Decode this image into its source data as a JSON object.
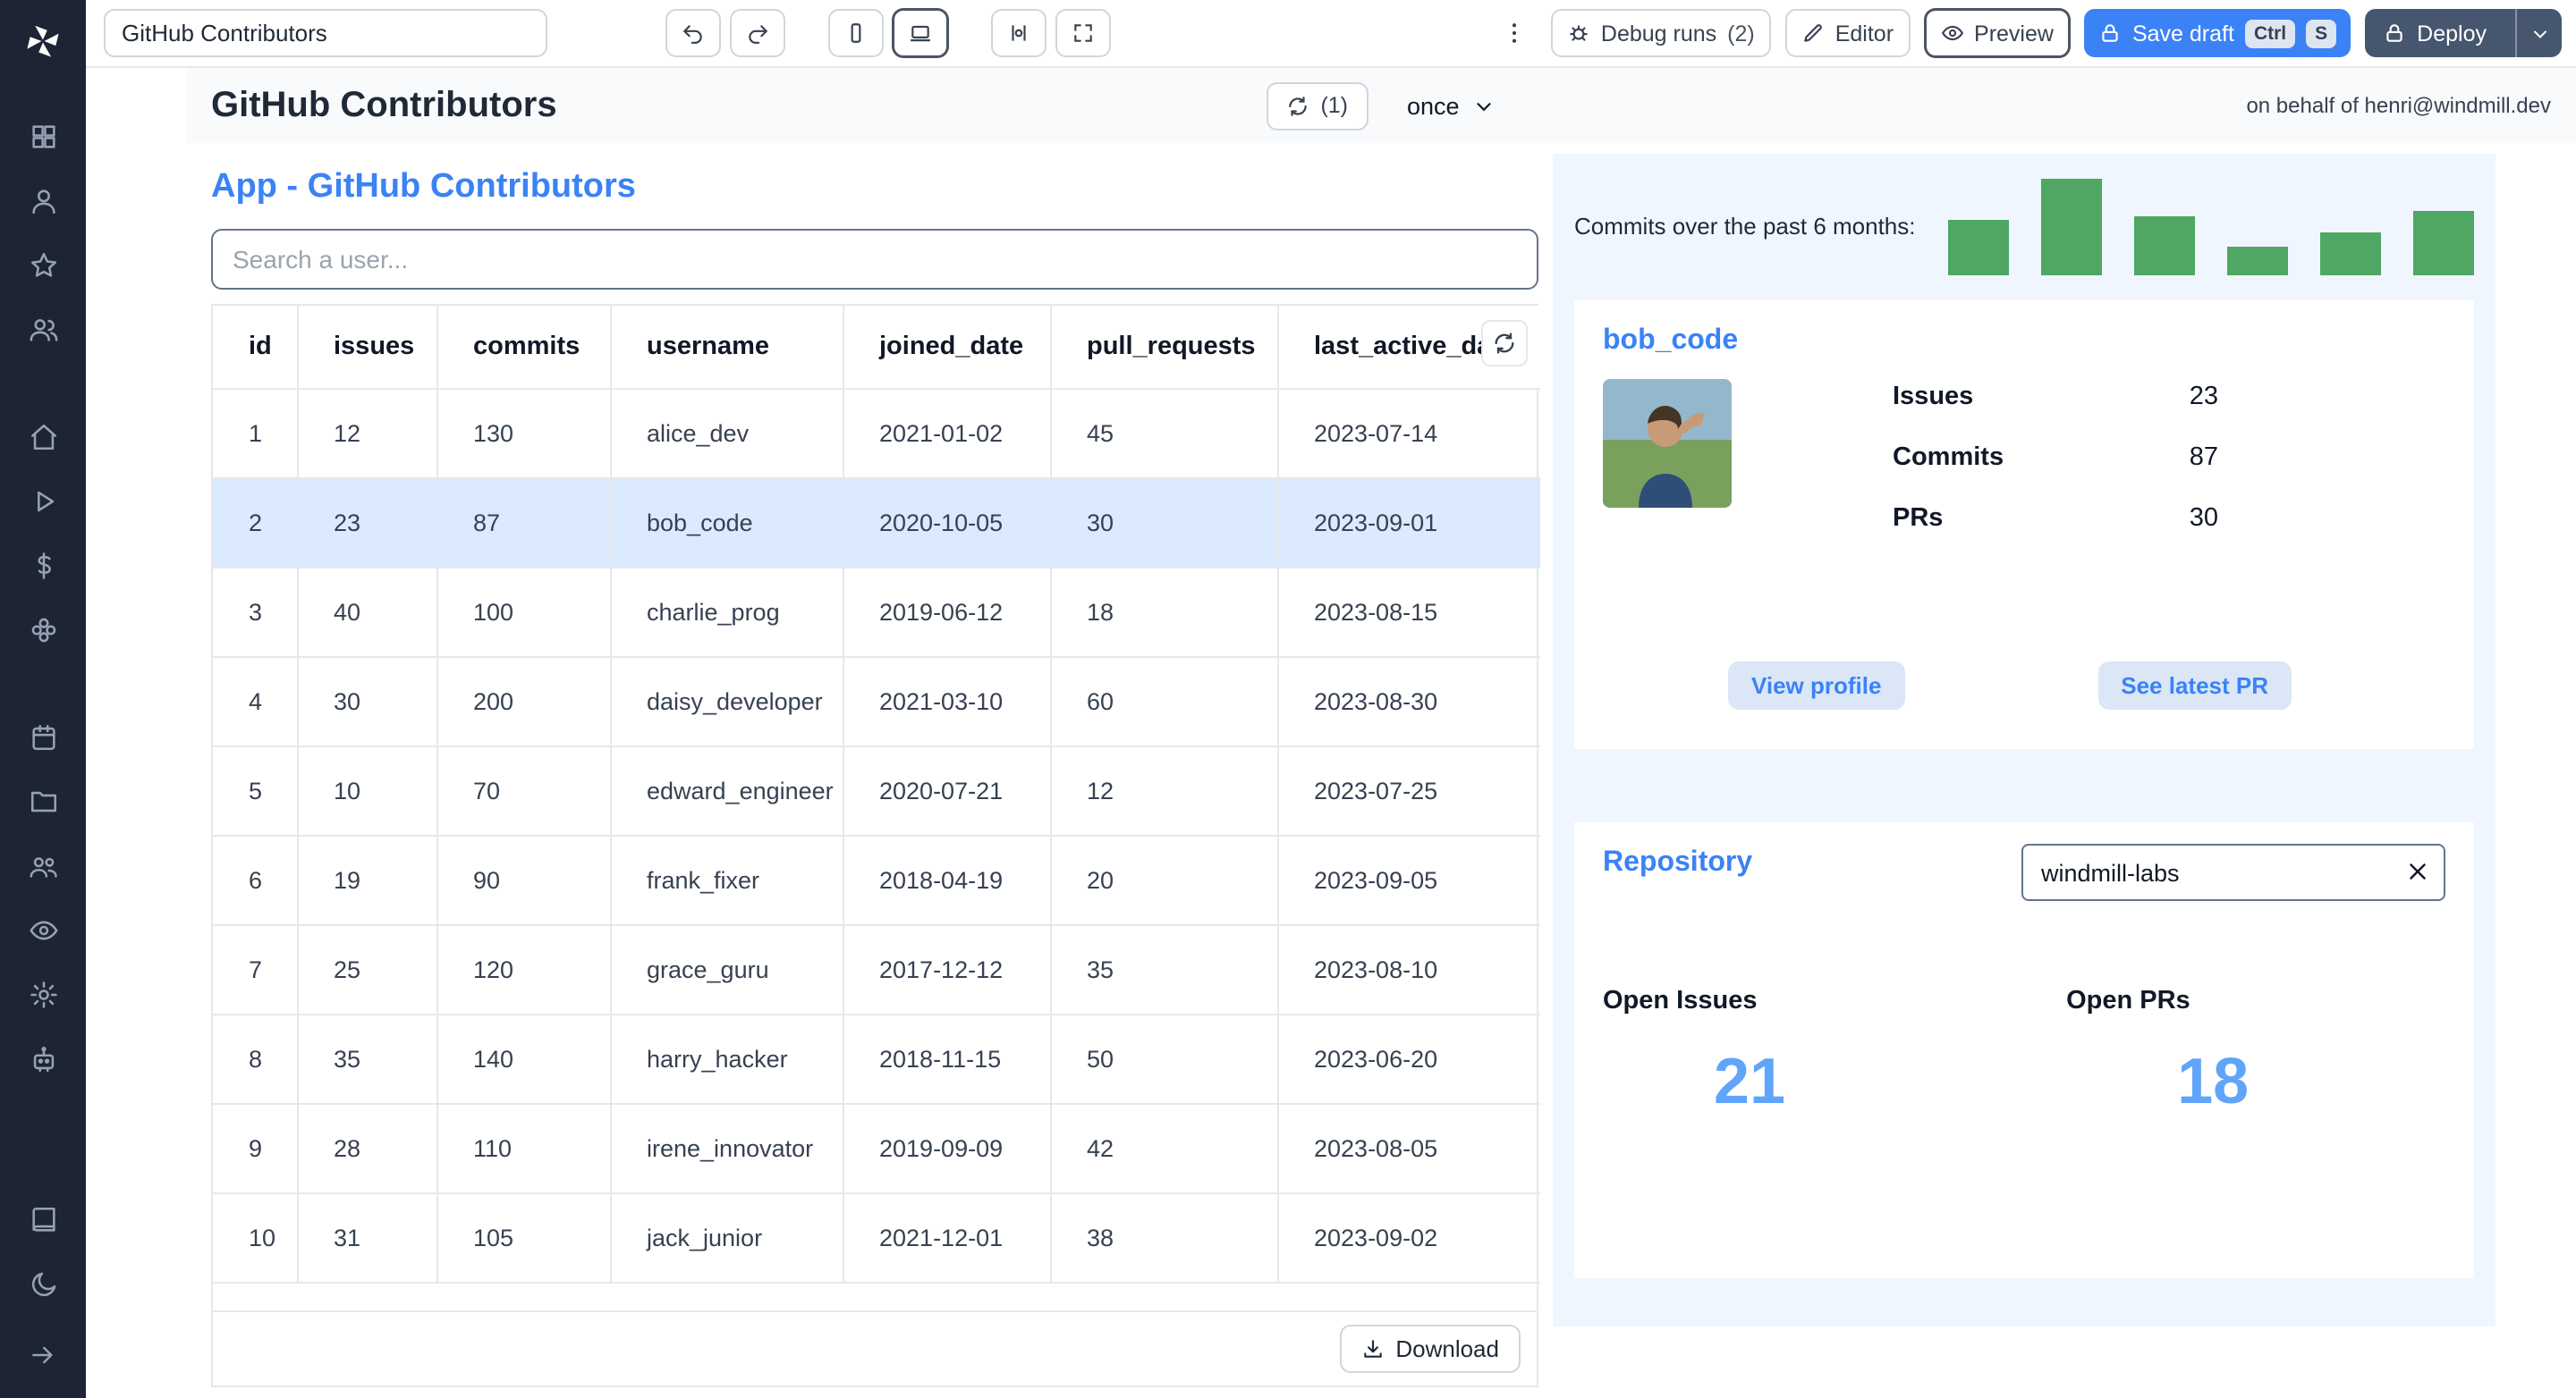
{
  "topbar": {
    "app_name_value": "GitHub Contributors",
    "debug_runs_label": "Debug runs",
    "debug_runs_count": "(2)",
    "editor_label": "Editor",
    "preview_label": "Preview",
    "save_draft_label": "Save draft",
    "save_kbd": [
      "Ctrl",
      "S"
    ],
    "deploy_label": "Deploy"
  },
  "sidebar": {
    "groups": [
      [
        "grid",
        "user",
        "star",
        "users"
      ],
      [
        "home",
        "play",
        "dollar",
        "flower"
      ],
      [
        "calendar",
        "folder",
        "team",
        "eye",
        "gear",
        "bot"
      ],
      [
        "book",
        "moon"
      ]
    ],
    "footer_icon": "arrow-right"
  },
  "header": {
    "title": "GitHub Contributors",
    "refresh_count": "(1)",
    "schedule_value": "once",
    "on_behalf": "on behalf of henri@windmill.dev"
  },
  "main": {
    "app_title": "App - GitHub Contributors",
    "search_placeholder": "Search a user...",
    "table": {
      "columns": [
        "id",
        "issues",
        "commits",
        "username",
        "joined_date",
        "pull_requests",
        "last_active_date"
      ],
      "rows": [
        [
          "1",
          "12",
          "130",
          "alice_dev",
          "2021-01-02",
          "45",
          "2023-07-14"
        ],
        [
          "2",
          "23",
          "87",
          "bob_code",
          "2020-10-05",
          "30",
          "2023-09-01"
        ],
        [
          "3",
          "40",
          "100",
          "charlie_prog",
          "2019-06-12",
          "18",
          "2023-08-15"
        ],
        [
          "4",
          "30",
          "200",
          "daisy_developer",
          "2021-03-10",
          "60",
          "2023-08-30"
        ],
        [
          "5",
          "10",
          "70",
          "edward_engineer",
          "2020-07-21",
          "12",
          "2023-07-25"
        ],
        [
          "6",
          "19",
          "90",
          "frank_fixer",
          "2018-04-19",
          "20",
          "2023-09-05"
        ],
        [
          "7",
          "25",
          "120",
          "grace_guru",
          "2017-12-12",
          "35",
          "2023-08-10"
        ],
        [
          "8",
          "35",
          "140",
          "harry_hacker",
          "2018-11-15",
          "50",
          "2023-06-20"
        ],
        [
          "9",
          "28",
          "110",
          "irene_innovator",
          "2019-09-09",
          "42",
          "2023-08-05"
        ],
        [
          "10",
          "31",
          "105",
          "jack_junior",
          "2021-12-01",
          "38",
          "2023-09-02"
        ]
      ],
      "selected_row_index": 1,
      "download_label": "Download"
    }
  },
  "right": {
    "chart": {
      "type": "bar",
      "label": "Commits over the past 6 months:",
      "values": [
        31,
        54,
        33,
        16,
        24,
        36
      ],
      "color": "#4fa763"
    },
    "user_card": {
      "title": "bob_code",
      "stats": [
        {
          "label": "Issues",
          "value": "23"
        },
        {
          "label": "Commits",
          "value": "87"
        },
        {
          "label": "PRs",
          "value": "30"
        }
      ],
      "view_profile_label": "View profile",
      "see_latest_pr_label": "See latest PR"
    },
    "repo_card": {
      "title": "Repository",
      "input_value": "windmill-labs",
      "open_issues_label": "Open Issues",
      "open_issues_value": "21",
      "open_prs_label": "Open PRs",
      "open_prs_value": "18"
    }
  },
  "colors": {
    "accent_blue": "#3b82f6",
    "bar_green": "#4fa763",
    "selected_row": "#dbeafe",
    "panel_blue": "#eff6ff",
    "big_number_blue": "#60a5fa",
    "sidebar_bg": "#1d2433"
  }
}
